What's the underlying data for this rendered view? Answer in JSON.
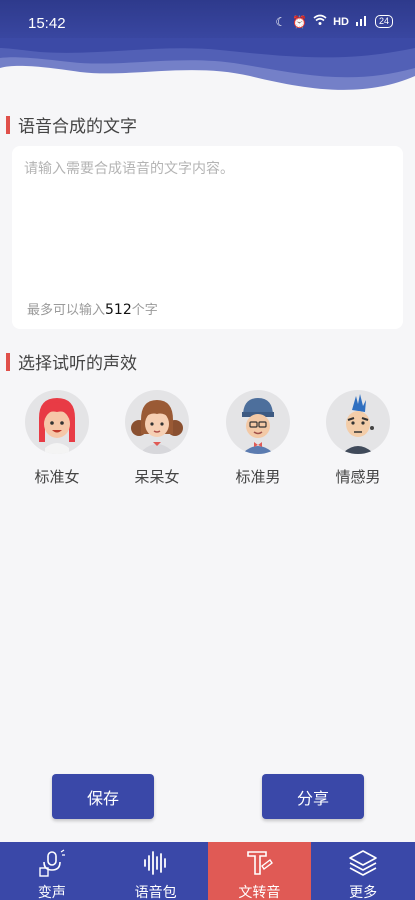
{
  "status": {
    "time": "15:42",
    "network": "HD",
    "battery": "24"
  },
  "text_section": {
    "title": "语音合成的文字",
    "placeholder": "请输入需要合成语音的文字内容。",
    "limit_prefix": "最多可以输入",
    "limit_count": "512",
    "limit_suffix": "个字"
  },
  "voice_section": {
    "title": "选择试听的声效",
    "voices": [
      {
        "label": "标准女",
        "icon": "avatar-red-girl-icon"
      },
      {
        "label": "呆呆女",
        "icon": "avatar-curly-girl-icon"
      },
      {
        "label": "标准男",
        "icon": "avatar-cap-boy-icon"
      },
      {
        "label": "情感男",
        "icon": "avatar-mohawk-boy-icon"
      }
    ]
  },
  "actions": {
    "save": "保存",
    "share": "分享"
  },
  "tabs": [
    {
      "label": "变声",
      "icon": "voice-change-icon",
      "active": false
    },
    {
      "label": "语音包",
      "icon": "waveform-icon",
      "active": false
    },
    {
      "label": "文转音",
      "icon": "text-to-speech-icon",
      "active": true
    },
    {
      "label": "更多",
      "icon": "layers-icon",
      "active": false
    }
  ],
  "colors": {
    "primary": "#3a48a8",
    "accent": "#e05a55",
    "background": "#f6f6f8"
  }
}
